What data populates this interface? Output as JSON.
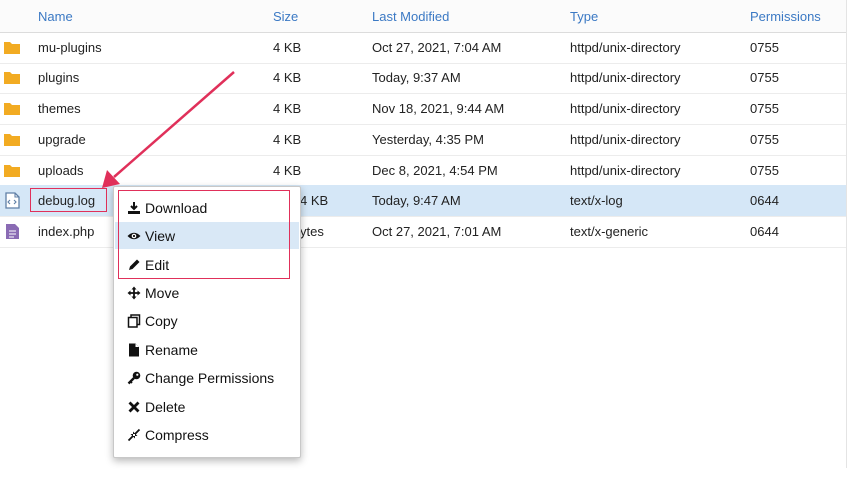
{
  "columns": {
    "name": "Name",
    "size": "Size",
    "modified": "Last Modified",
    "type": "Type",
    "permissions": "Permissions"
  },
  "rows": [
    {
      "name": "mu-plugins",
      "size": "4 KB",
      "modified": "Oct 27, 2021, 7:04 AM",
      "type": "httpd/unix-directory",
      "perm": "0755",
      "icon": "folder-icon"
    },
    {
      "name": "plugins",
      "size": "4 KB",
      "modified": "Today, 9:37 AM",
      "type": "httpd/unix-directory",
      "perm": "0755",
      "icon": "folder-icon"
    },
    {
      "name": "themes",
      "size": "4 KB",
      "modified": "Nov 18, 2021, 9:44 AM",
      "type": "httpd/unix-directory",
      "perm": "0755",
      "icon": "folder-icon"
    },
    {
      "name": "upgrade",
      "size": "4 KB",
      "modified": "Yesterday, 4:35 PM",
      "type": "httpd/unix-directory",
      "perm": "0755",
      "icon": "folder-icon"
    },
    {
      "name": "uploads",
      "size": "4 KB",
      "modified": "Dec 8, 2021, 4:54 PM",
      "type": "httpd/unix-directory",
      "perm": "0755",
      "icon": "folder-icon"
    },
    {
      "name": "debug.log",
      "size": "4 KB",
      "modified": "Today, 9:47 AM",
      "type": "text/x-log",
      "perm": "0644",
      "icon": "code-file-icon"
    },
    {
      "name": "index.php",
      "size": "ytes",
      "modified": "Oct 27, 2021, 7:01 AM",
      "type": "text/x-generic",
      "perm": "0644",
      "icon": "text-file-icon"
    }
  ],
  "context_menu": {
    "items": [
      {
        "label": "Download",
        "icon": "download-icon"
      },
      {
        "label": "View",
        "icon": "eye-icon"
      },
      {
        "label": "Edit",
        "icon": "pencil-icon"
      },
      {
        "label": "Move",
        "icon": "move-arrows-icon"
      },
      {
        "label": "Copy",
        "icon": "copy-icon"
      },
      {
        "label": "Rename",
        "icon": "file-icon"
      },
      {
        "label": "Change Permissions",
        "icon": "key-icon"
      },
      {
        "label": "Delete",
        "icon": "x-icon"
      },
      {
        "label": "Compress",
        "icon": "compress-icon"
      }
    ]
  },
  "colors": {
    "header_text": "#3b79c4",
    "selected_row": "#d5e7f7",
    "annotation": "#e0305a",
    "folder": "#f2ab22"
  }
}
